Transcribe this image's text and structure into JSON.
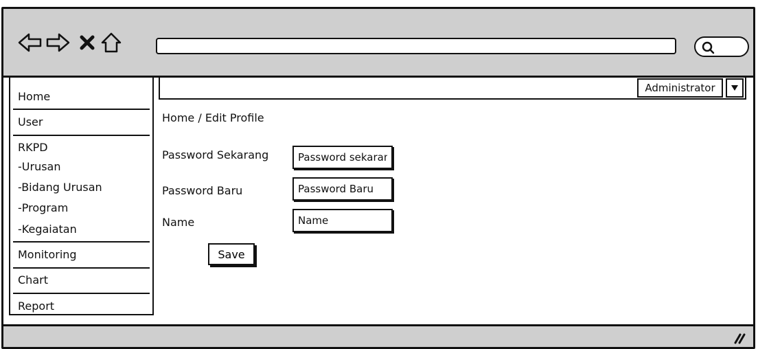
{
  "browser": {
    "icons": [
      "back-arrow-icon",
      "forward-arrow-icon",
      "close-icon",
      "home-icon",
      "search-icon"
    ],
    "url": ""
  },
  "sidebar": {
    "items": [
      {
        "label": "Home"
      },
      {
        "label": "User"
      },
      {
        "label": "RKPD"
      },
      {
        "label": "-Urusan"
      },
      {
        "label": "-Bidang Urusan"
      },
      {
        "label": "-Program"
      },
      {
        "label": "-Kegaiatan"
      },
      {
        "label": "Monitoring"
      },
      {
        "label": "Chart"
      },
      {
        "label": "Report"
      }
    ]
  },
  "topbar": {
    "user_label": "Administrator",
    "caret_icon": "caret-down-icon"
  },
  "breadcrumb": "Home / Edit Profile",
  "form": {
    "current_password_label": "Password Sekarang",
    "current_password_placeholder": "Password sekarang",
    "new_password_label": "Password Baru",
    "new_password_placeholder": "Password Baru",
    "name_label": "Name",
    "name_placeholder": "Name",
    "save_label": "Save"
  },
  "colors": {
    "chrome_gray": "#cfcfcf",
    "ink": "#111111",
    "background": "#ffffff"
  }
}
